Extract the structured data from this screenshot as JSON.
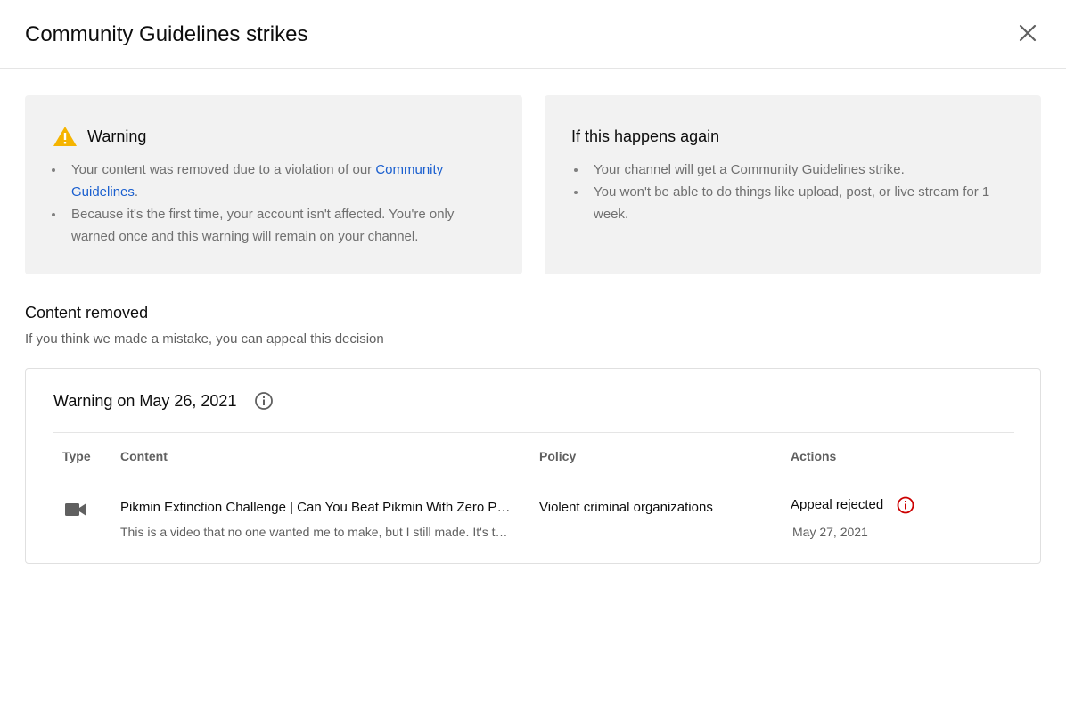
{
  "dialog": {
    "title": "Community Guidelines strikes",
    "close_icon": "close-icon"
  },
  "warning_card": {
    "icon": "warning-triangle-icon",
    "icon_color": "#f5b400",
    "title": "Warning",
    "bullet1_before": "Your content was removed due to a violation of our ",
    "bullet1_link": "Community Guidelines",
    "bullet1_after": ".",
    "bullet2": "Because it's the first time, your account isn't affected. You're only warned once and this warning will remain on your channel."
  },
  "again_card": {
    "title": "If this happens again",
    "bullets": [
      "Your channel will get a Community Guidelines strike.",
      "You won't be able to do things like upload, post, or live stream for 1 week."
    ]
  },
  "content_removed": {
    "title": "Content removed",
    "subtitle": "If you think we made a mistake, you can appeal this decision"
  },
  "panel": {
    "title": "Warning on May 26, 2021",
    "info_icon": "info-icon",
    "columns": [
      "Type",
      "Content",
      "Policy",
      "Actions"
    ],
    "row": {
      "type_icon": "video-camera-icon",
      "content_title": "Pikmin Extinction Challenge | Can You Beat Pikmin With Zero Pikmin?",
      "content_desc": "This is a video that no one wanted me to make, but I still made. It's the one video",
      "policy": "Violent criminal organizations",
      "action_status": "Appeal rejected",
      "action_icon": "alert-circle-icon",
      "action_icon_color": "#cc0000",
      "action_date": "May 27, 2021"
    }
  },
  "colors": {
    "card_bg": "#f2f2f2",
    "link": "#1a5fcf",
    "muted_text": "#707070"
  }
}
